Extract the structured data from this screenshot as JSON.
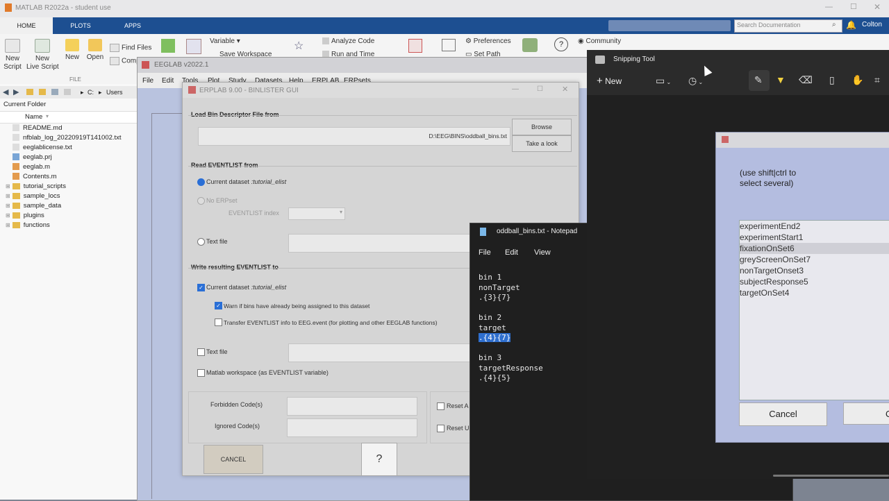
{
  "matlab": {
    "title": "MATLAB R2022a - student use",
    "tabs": [
      "HOME",
      "PLOTS",
      "APPS"
    ],
    "search_placeholder": "Search Documentation",
    "user": "Colton",
    "ribbon": {
      "new_script": "New\nScript",
      "new_live_script": "New\nLive Script",
      "new": "New",
      "open": "Open",
      "find_files": "Find Files",
      "compare": "Comp",
      "file_group": "FILE",
      "variable": "Variable",
      "save_workspace": "Save Workspace",
      "analyze_code": "Analyze Code",
      "run_and_time": "Run and Time",
      "preferences": "Preferences",
      "set_path": "Set Path",
      "community": "Community"
    },
    "path": [
      "C:",
      "Users"
    ],
    "current_folder_label": "Current Folder",
    "name_column": "Name",
    "files": [
      "README.md",
      "nfblab_log_20220919T141002.txt",
      "eeglablicense.txt",
      "eeglab.prj",
      "eeglab.m",
      "Contents.m"
    ],
    "folders": [
      "tutorial_scripts",
      "sample_locs",
      "sample_data",
      "plugins",
      "functions"
    ]
  },
  "eeglab": {
    "title": "EEGLAB v2022.1",
    "menu": [
      "File",
      "Edit",
      "Tools",
      "Plot",
      "Study",
      "Datasets",
      "Help",
      "ERPLAB",
      "ERPsets"
    ]
  },
  "erplab": {
    "title": "ERPLAB 9.00 - BINLISTER GUI",
    "load_bdf_label": "Load Bin Descriptor File from",
    "bdf_path": "D:\\EEG\\BINS\\oddball_bins.txt",
    "browse": "Browse",
    "take_a_look": "Take a look",
    "read_eventlist_label": "Read EVENTLIST from",
    "current_dataset": "Current dataset",
    "dataset_name": ":tutorial_elist",
    "no_erpset": "No ERPset",
    "eventlist_index": "EVENTLIST index",
    "text_file": "Text file",
    "write_label": "Write resulting EVENTLIST to",
    "warn_bins": "Warn if bins have already being assigned to this dataset",
    "transfer": "Transfer EVENTLIST info to EEG.event (for plotting and other EEGLAB functions)",
    "matlab_workspace": "Matlab workspace (as EVENTLIST variable)",
    "forbidden_codes": "Forbidden Code(s)",
    "ignored_codes": "Ignored Code(s)",
    "reset_a": "Reset A",
    "reset_u": "Reset U",
    "cancel": "CANCEL",
    "help": "?"
  },
  "notepad": {
    "title": "oddball_bins.txt - Notepad",
    "menu": [
      "File",
      "Edit",
      "View"
    ],
    "lines": [
      "bin 1",
      "nonTarget",
      ".{3}{7}",
      "",
      "bin 2",
      "target",
      ".{4}{7}",
      "",
      "bin 3",
      "targetResponse",
      ".{4}{5}"
    ],
    "selected_line_index": 6
  },
  "snipping": {
    "title": "Snipping Tool",
    "new_label": "New"
  },
  "event_dialog": {
    "hint": "(use shift|ctrl to\nselect several)",
    "items": [
      "experimentEnd2",
      "experimentStart1",
      "fixationOnSet6",
      "greyScreenOnSet7",
      "nonTargetOnset3",
      "subjectResponse5",
      "targetOnSet4"
    ],
    "selected_index": 2,
    "cancel": "Cancel",
    "ok": "Ok"
  }
}
